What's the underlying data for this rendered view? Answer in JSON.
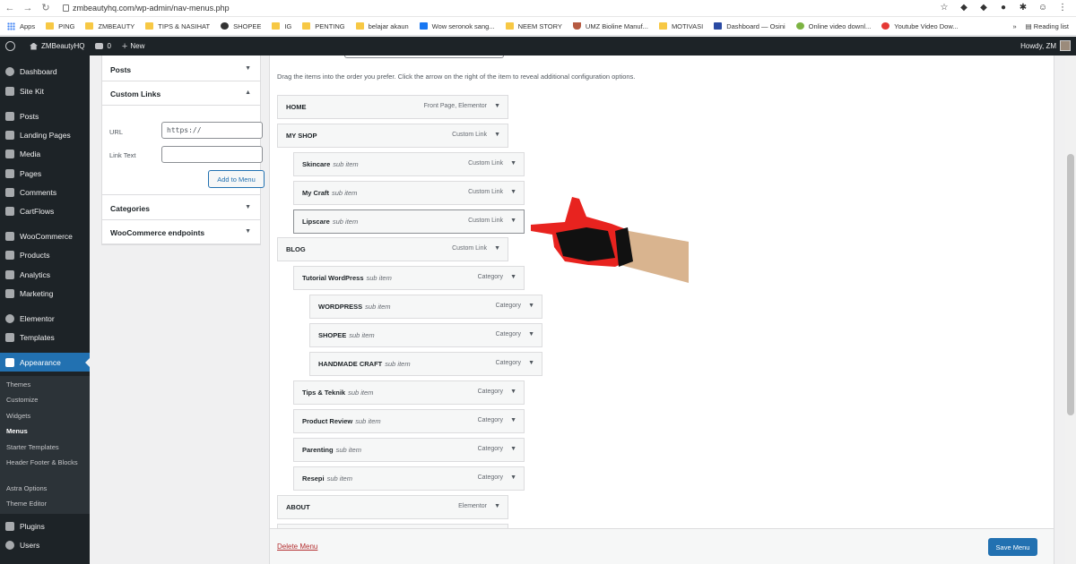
{
  "browser": {
    "url": "zmbeautyhq.com/wp-admin/nav-menus.php",
    "bookmarks": [
      "Apps",
      "PING",
      "ZMBEAUTY",
      "TIPS & NASIHAT",
      "SHOPEE",
      "IG",
      "PENTING",
      "belajar akaun",
      "Wow seronok sang...",
      "NEEM STORY",
      "UMZ Bioline Manuf...",
      "MOTIVASI",
      "Dashboard — Osini",
      "Online video downl...",
      "Youtube Video Dow..."
    ],
    "reading_list": "Reading list",
    "overflow": "»"
  },
  "adminbar": {
    "site_name": "ZMBeautyHQ",
    "comments_count": "0",
    "new_label": "New",
    "howdy": "Howdy, ZM"
  },
  "sidebar": {
    "items": [
      "Dashboard",
      "Site Kit",
      "Posts",
      "Landing Pages",
      "Media",
      "Pages",
      "Comments",
      "CartFlows",
      "WooCommerce",
      "Products",
      "Analytics",
      "Marketing",
      "Elementor",
      "Templates",
      "Appearance",
      "Plugins",
      "Users"
    ],
    "appearance_submenu": [
      "Themes",
      "Customize",
      "Widgets",
      "Menus",
      "Starter Templates",
      "Header Footer & Blocks",
      "Astra Options",
      "Theme Editor"
    ]
  },
  "add_items": {
    "posts": "Posts",
    "custom_links": "Custom Links",
    "url_label": "URL",
    "url_value": "https://",
    "link_text_label": "Link Text",
    "link_text_value": "",
    "add_button": "Add to Menu",
    "categories": "Categories",
    "woo_endpoints": "WooCommerce endpoints"
  },
  "menu_structure": {
    "instructions": "Drag the items into the order you prefer. Click the arrow on the right of the item to reveal additional configuration options.",
    "sub_item_label": "sub item",
    "items": [
      {
        "title": "HOME",
        "type": "Front Page, Elementor",
        "sub": false
      },
      {
        "title": "MY SHOP",
        "type": "Custom Link",
        "sub": false
      },
      {
        "title": "Skincare",
        "type": "Custom Link",
        "sub": true
      },
      {
        "title": "My Craft",
        "type": "Custom Link",
        "sub": true
      },
      {
        "title": "Lipscare",
        "type": "Custom Link",
        "sub": true
      },
      {
        "title": "BLOG",
        "type": "Custom Link",
        "sub": false
      },
      {
        "title": "Tutorial WordPress",
        "type": "Category",
        "sub": true
      },
      {
        "title": "WORDPRESS",
        "type": "Category",
        "sub": true
      },
      {
        "title": "SHOPEE",
        "type": "Category",
        "sub": true
      },
      {
        "title": "HANDMADE CRAFT",
        "type": "Category",
        "sub": true
      },
      {
        "title": "Tips & Teknik",
        "type": "Category",
        "sub": true
      },
      {
        "title": "Product Review",
        "type": "Category",
        "sub": true
      },
      {
        "title": "Parenting",
        "type": "Category",
        "sub": true
      },
      {
        "title": "Resepi",
        "type": "Category",
        "sub": true
      },
      {
        "title": "ABOUT",
        "type": "Elementor",
        "sub": false
      }
    ],
    "delete_link": "Delete Menu",
    "save_button": "Save Menu"
  },
  "colors": {
    "admin_dark": "#1d2327",
    "accent": "#2271b1",
    "delete": "#b32d2e",
    "glove_red": "#e8231f"
  }
}
